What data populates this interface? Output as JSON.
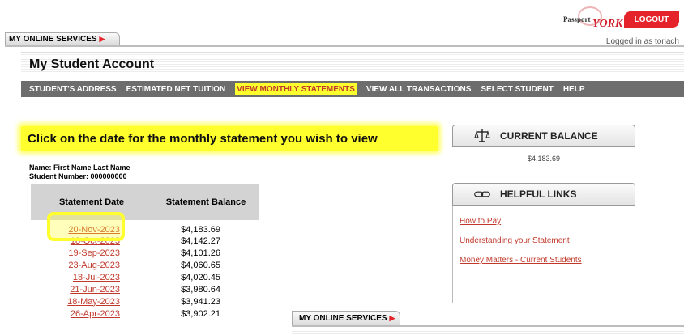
{
  "header": {
    "services_tab": "MY ONLINE SERVICES",
    "logo_line1": "Passport",
    "logo_line2": "YORK",
    "logout_label": "LOGOUT",
    "logged_in_text": "Logged in as toriach",
    "page_title": "My Student Account"
  },
  "nav": {
    "items": [
      {
        "label": "STUDENT'S ADDRESS"
      },
      {
        "label": "ESTIMATED NET TUITION"
      },
      {
        "label": "VIEW MONTHLY STATEMENTS",
        "active": true
      },
      {
        "label": "VIEW ALL TRANSACTIONS"
      },
      {
        "label": "SELECT STUDENT"
      },
      {
        "label": "HELP"
      }
    ]
  },
  "instruction": "Click on the date for the monthly statement you wish to view",
  "student": {
    "name_label": "Name:",
    "name_value": "First Name Last Name",
    "number_label": "Student Number:",
    "number_value": "000000000"
  },
  "statements": {
    "columns": [
      "Statement Date",
      "Statement Balance"
    ],
    "rows": [
      {
        "date": "20-Nov-2023",
        "balance": "$4,183.69"
      },
      {
        "date": "18-Oct-2023",
        "balance": "$4,142.27"
      },
      {
        "date": "19-Sep-2023",
        "balance": "$4,101.26"
      },
      {
        "date": "23-Aug-2023",
        "balance": "$4,060.65"
      },
      {
        "date": "18-Jul-2023",
        "balance": "$4,020.45"
      },
      {
        "date": "21-Jun-2023",
        "balance": "$3,980.64"
      },
      {
        "date": "18-May-2023",
        "balance": "$3,941.23"
      },
      {
        "date": "26-Apr-2023",
        "balance": "$3,902.21"
      }
    ]
  },
  "current_balance": {
    "title": "CURRENT BALANCE",
    "value": "$4,183.69",
    "icon": "scales-icon"
  },
  "helpful_links": {
    "title": "HELPFUL LINKS",
    "icon": "chain-link-icon",
    "links": [
      "How to Pay",
      "Understanding your Statement",
      "Money Matters - Current Students"
    ]
  },
  "footer": {
    "services_tab": "MY ONLINE SERVICES"
  },
  "colors": {
    "accent_red": "#e4232a",
    "link_red": "#c0392b",
    "highlight_yellow": "#ffff2e",
    "nav_gray": "#6d6d6d"
  }
}
